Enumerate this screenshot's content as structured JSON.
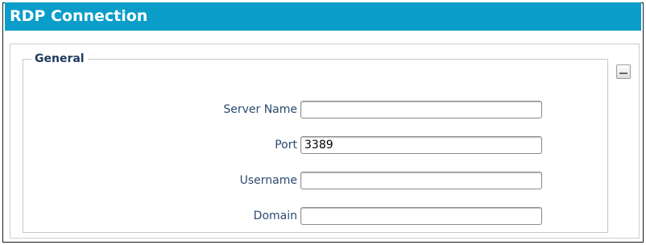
{
  "window": {
    "title": "RDP Connection"
  },
  "colors": {
    "title_bar": "#0a9dc9",
    "title_text": "#ffffff",
    "label_text": "#2a4a6e"
  },
  "general": {
    "legend": "General",
    "collapse_icon": "minus-icon",
    "fields": {
      "server_name": {
        "label": "Server Name",
        "value": ""
      },
      "port": {
        "label": "Port",
        "value": "3389"
      },
      "username": {
        "label": "Username",
        "value": ""
      },
      "domain": {
        "label": "Domain",
        "value": ""
      }
    }
  }
}
